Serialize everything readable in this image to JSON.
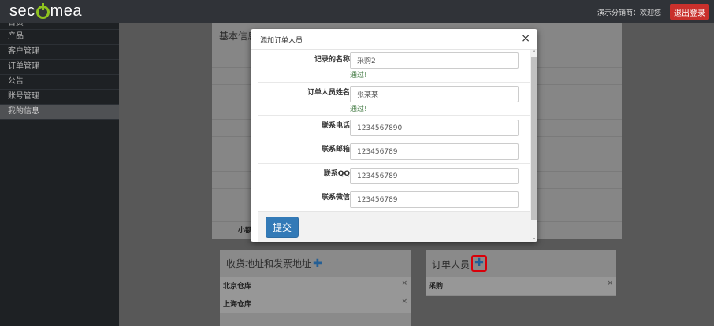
{
  "header": {
    "logo_text_pre": "sec",
    "logo_text_post": "mea",
    "greeting": "演示分销商：欢迎您",
    "logout_label": "退出登录"
  },
  "sidebar": {
    "items": [
      {
        "label": "首页"
      },
      {
        "label": "产品"
      },
      {
        "label": "客户管理"
      },
      {
        "label": "订单管理"
      },
      {
        "label": "公告"
      },
      {
        "label": "账号管理"
      },
      {
        "label": "我的信息",
        "active": true
      }
    ]
  },
  "main": {
    "basic_info_title": "基本信息",
    "basic_info_partial_label": "小额",
    "address_panel": {
      "title": "收货地址和发票地址",
      "items": [
        {
          "label": "北京仓库"
        },
        {
          "label": "上海仓库"
        }
      ]
    },
    "order_person_panel": {
      "title": "订单人员",
      "items": [
        {
          "label": "采购"
        }
      ]
    },
    "remove_glyph": "×",
    "add_glyph": "✚"
  },
  "modal": {
    "title": "添加订单人员",
    "close_glyph": "×",
    "fields": [
      {
        "label": "记录的名称",
        "value": "采购2",
        "status": "通过!"
      },
      {
        "label": "订单人员姓名",
        "value": "张某某",
        "status": "通过!"
      },
      {
        "label": "联系电话",
        "value": "1234567890"
      },
      {
        "label": "联系邮箱",
        "value": "123456789"
      },
      {
        "label": "联系QQ",
        "value": "123456789"
      },
      {
        "label": "联系微信",
        "value": "123456789"
      }
    ],
    "submit_label": "提交",
    "scroll_up_glyph": "⌃",
    "scroll_down_glyph": "⌄"
  },
  "colors": {
    "topbar": "#303338",
    "sidebar": "#1e2124",
    "logo_accent": "#8fc31f",
    "logout_button": "#c9302c",
    "primary_button": "#337ab7",
    "success_text": "#3c763d",
    "highlight_box": "#d9000a"
  }
}
